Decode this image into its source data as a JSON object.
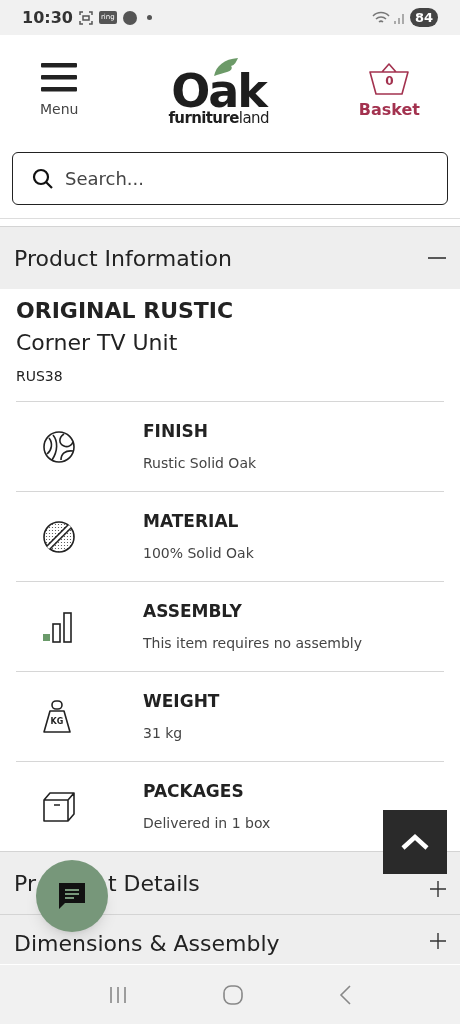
{
  "status_bar": {
    "time": "10:30",
    "app_badge": "ring",
    "battery": "84"
  },
  "header": {
    "menu_label": "Menu",
    "logo_main": "Oak",
    "logo_sub": "**furniture**land",
    "basket_count": "0",
    "basket_label": "Basket"
  },
  "search": {
    "placeholder": "Search..."
  },
  "sections": [
    {
      "title": "Product Information",
      "expanded": true,
      "product": {
        "range": "ORIGINAL RUSTIC",
        "name": "Corner TV Unit",
        "sku": "RUS38",
        "specs": [
          {
            "kind": "finish",
            "label": "FINISH",
            "value": "Rustic Solid Oak"
          },
          {
            "kind": "material",
            "label": "MATERIAL",
            "value": "100% Solid Oak"
          },
          {
            "kind": "assembly",
            "label": "ASSEMBLY",
            "value": "This item requires no assembly"
          },
          {
            "kind": "weight",
            "label": "WEIGHT",
            "value": "31 kg",
            "icon_text": "KG"
          },
          {
            "kind": "packages",
            "label": "PACKAGES",
            "value": "Delivered in 1 box"
          }
        ]
      }
    },
    {
      "title_parts": [
        "Pr",
        "t Details"
      ],
      "expanded": false
    },
    {
      "title": "Dimensions & Assembly",
      "expanded": false
    }
  ]
}
